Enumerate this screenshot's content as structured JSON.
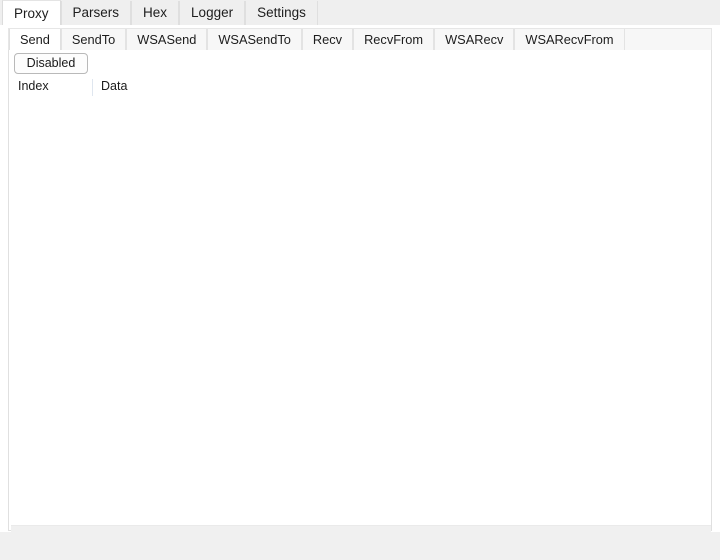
{
  "window": {
    "accent_border_color": "#2b2f3a",
    "background_color": "#f0f0f0"
  },
  "primary_tabs": {
    "selected": "Proxy",
    "items": [
      {
        "label": "Proxy"
      },
      {
        "label": "Parsers"
      },
      {
        "label": "Hex"
      },
      {
        "label": "Logger"
      },
      {
        "label": "Settings"
      }
    ]
  },
  "secondary_tabs": {
    "selected": "Send",
    "items": [
      {
        "label": "Send"
      },
      {
        "label": "SendTo"
      },
      {
        "label": "WSASend"
      },
      {
        "label": "WSASendTo"
      },
      {
        "label": "Recv"
      },
      {
        "label": "RecvFrom"
      },
      {
        "label": "WSARecv"
      },
      {
        "label": "WSARecvFrom"
      }
    ]
  },
  "toolbar": {
    "toggle_label": "Disabled"
  },
  "grid": {
    "columns": [
      {
        "key": "index",
        "label": "Index"
      },
      {
        "key": "data",
        "label": "Data"
      }
    ],
    "rows": []
  },
  "scrollbar": {
    "orientation": "horizontal",
    "thumb_color": "#7a7a7a"
  }
}
